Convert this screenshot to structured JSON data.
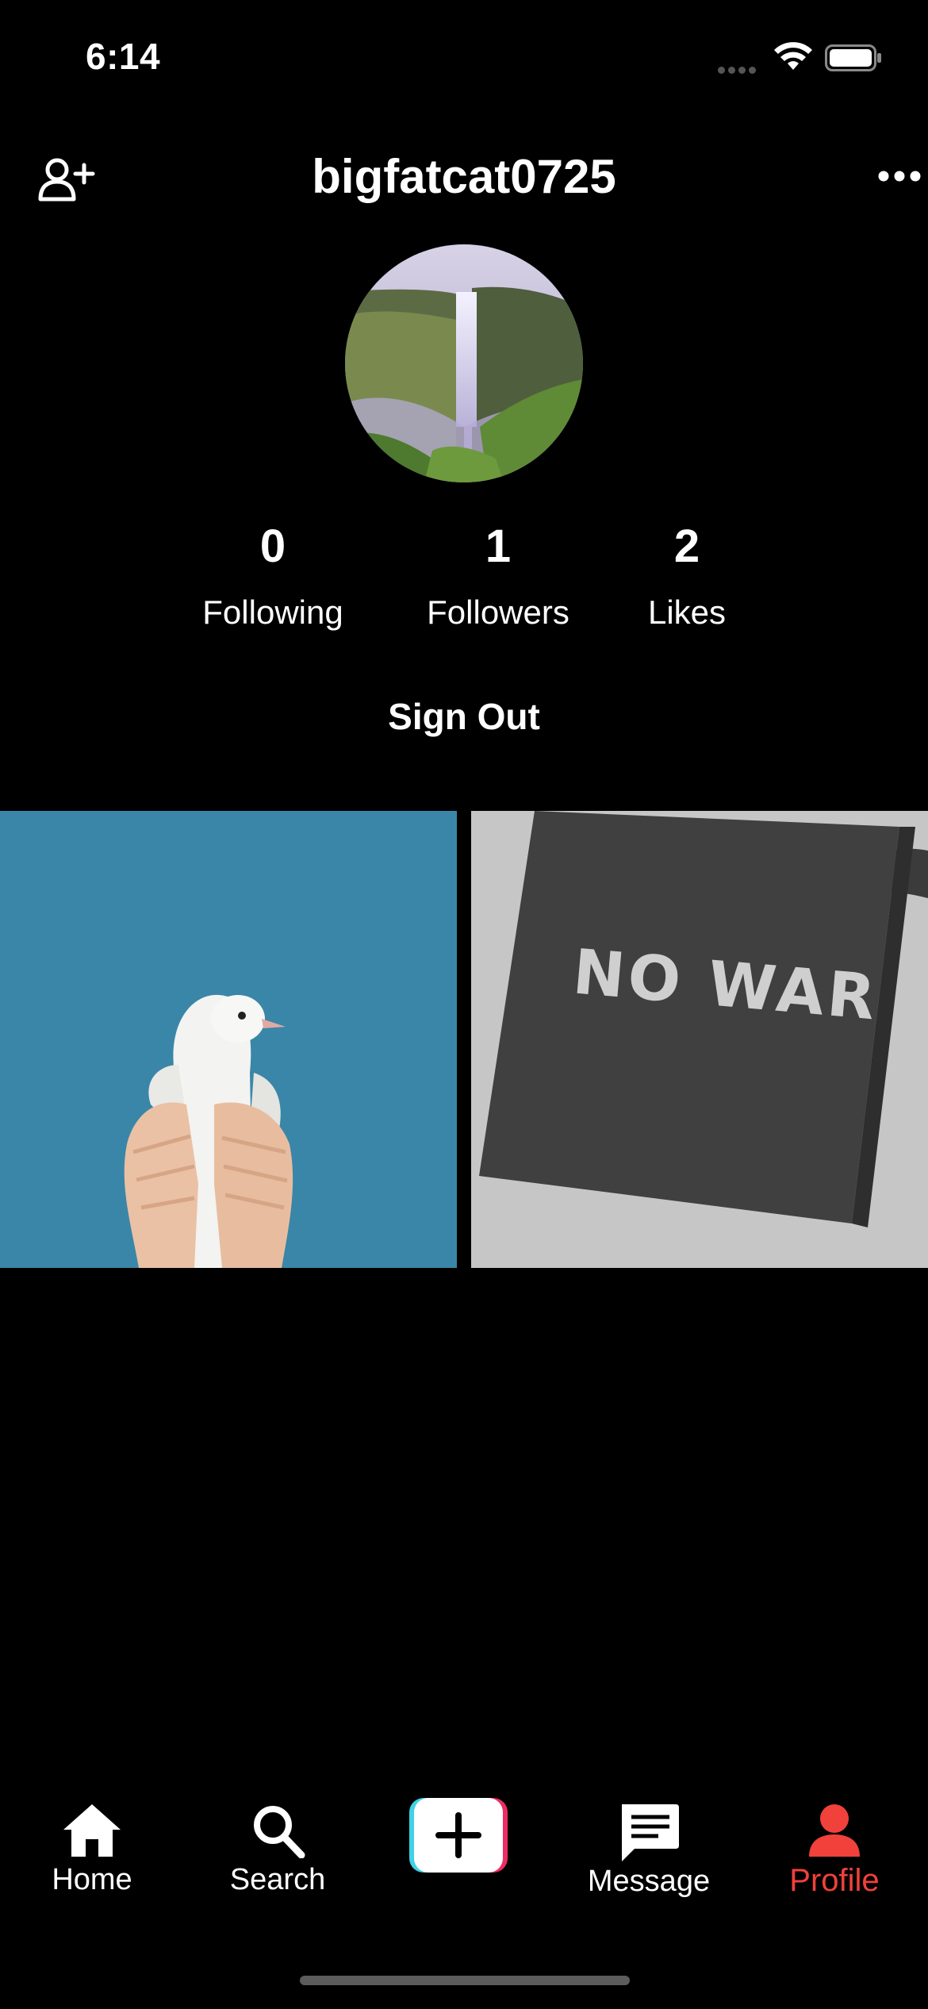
{
  "status_bar": {
    "time": "6:14"
  },
  "header": {
    "username": "bigfatcat0725"
  },
  "stats": [
    {
      "value": "0",
      "label": "Following"
    },
    {
      "value": "1",
      "label": "Followers"
    },
    {
      "value": "2",
      "label": "Likes"
    }
  ],
  "actions": {
    "sign_out": "Sign Out"
  },
  "videos": [
    {
      "name": "dove-in-hands-thumbnail"
    },
    {
      "name": "no-war-sign-thumbnail",
      "caption": "NO WAR"
    }
  ],
  "tabbar": {
    "home": "Home",
    "search": "Search",
    "message": "Message",
    "profile": "Profile",
    "active": "profile",
    "active_color": "#f0413b"
  }
}
